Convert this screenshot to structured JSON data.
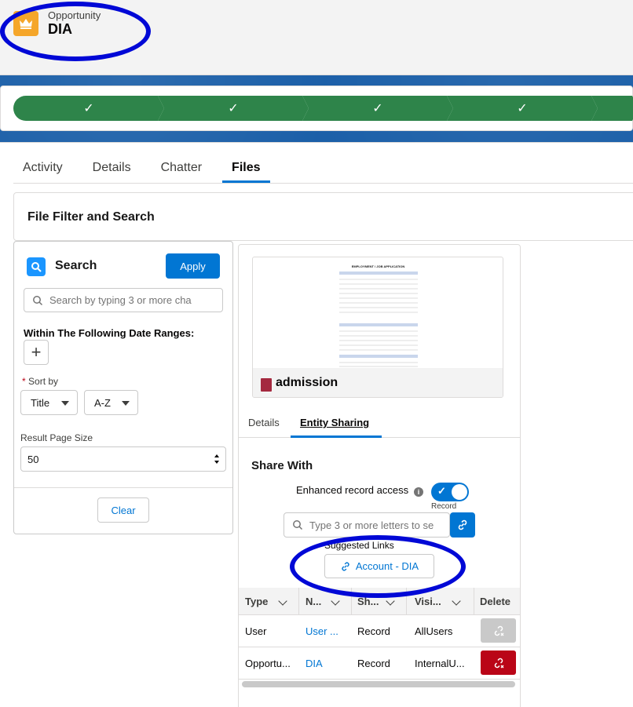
{
  "header": {
    "object_label": "Opportunity",
    "record_name": "DIA"
  },
  "path": {
    "steps": [
      "✓",
      "✓",
      "✓",
      "✓"
    ]
  },
  "tabs": [
    {
      "label": "Activity"
    },
    {
      "label": "Details"
    },
    {
      "label": "Chatter"
    },
    {
      "label": "Files"
    }
  ],
  "filter": {
    "title": "File Filter and Search"
  },
  "search_panel": {
    "title": "Search",
    "apply_label": "Apply",
    "search_placeholder": "Search by typing 3 or more cha",
    "date_ranges_label": "Within The Following Date Ranges:",
    "add_label": "+",
    "sort_required_mark": "*",
    "sort_label": "Sort by",
    "sort_field": "Title",
    "sort_order": "A-Z",
    "page_size_label": "Result Page Size",
    "page_size_value": "50",
    "clear_label": "Clear"
  },
  "file": {
    "name": "admission",
    "doc_title": "EMPLOYMENT / JOB APPLICATION",
    "sub_tabs": [
      {
        "label": "Details"
      },
      {
        "label": "Entity Sharing"
      }
    ],
    "share_with_title": "Share With",
    "enhanced_access_label": "Enhanced record access",
    "info_glyph": "i",
    "toggle_caption": "Record",
    "share_search_placeholder": "Type 3 or more letters to se",
    "suggested_links_label": "Suggested Links",
    "suggested_link": "Account - DIA"
  },
  "table": {
    "columns": [
      "Type",
      "N...",
      "Sh...",
      "Visi...",
      "Delete"
    ],
    "rows": [
      {
        "type": "User",
        "name": "User ...",
        "share": "Record",
        "visibility": "AllUsers"
      },
      {
        "type": "Opportu...",
        "name": "DIA",
        "share": "Record",
        "visibility": "InternalU..."
      }
    ]
  },
  "colors": {
    "brand": "#0176d3",
    "success": "#2e844a",
    "annotation": "#0008d6",
    "delete_active": "#ba0517"
  }
}
